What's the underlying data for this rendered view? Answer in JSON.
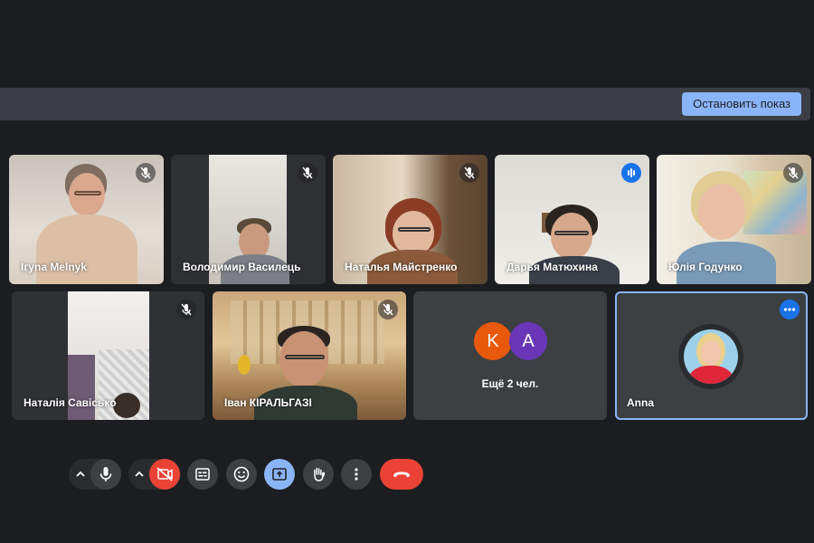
{
  "presenting_bar": {
    "stop_button": "Остановить показ"
  },
  "tiles": [
    {
      "name": "Iгуna Melnyk",
      "status": "muted"
    },
    {
      "name": "Володимир Василець",
      "status": "muted"
    },
    {
      "name": "Наталья Майстренко",
      "status": "muted"
    },
    {
      "name": "Дарья Матюхина",
      "status": "speaking"
    },
    {
      "name": "Юлія Годунко",
      "status": "muted"
    },
    {
      "name": "Наталія Савісько",
      "status": "muted"
    },
    {
      "name": "Іван КІРАЛЬГАЗІ",
      "status": "muted"
    },
    {
      "name": "Anna",
      "status": "active-options"
    }
  ],
  "more_tile": {
    "avatars": [
      {
        "letter": "K",
        "color": "#e8590c"
      },
      {
        "letter": "A",
        "color": "#6a36b8"
      }
    ],
    "label": "Ещё 2 чел."
  },
  "controls": [
    "chevron-up-icon",
    "mic-icon",
    "chevron-up-icon",
    "camera-off-icon",
    "captions-icon",
    "emoji-icon",
    "present-screen-icon",
    "raise-hand-icon",
    "more-options-icon",
    "end-call-icon"
  ],
  "colors": {
    "background": "#1c1d20",
    "tile": "#3c4043",
    "accent_blue": "#8ab4f8",
    "camera_off_red": "#ea4335",
    "end_call_red": "#ea4335",
    "speaking_blue": "#1a73e8"
  }
}
